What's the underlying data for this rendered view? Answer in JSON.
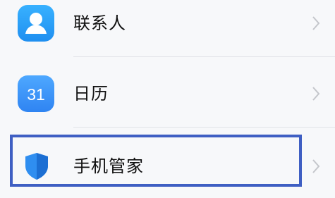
{
  "items": [
    {
      "label": "联系人",
      "icon": "contacts-icon"
    },
    {
      "label": "日历",
      "icon": "calendar-icon",
      "icon_text": "31"
    },
    {
      "label": "手机管家",
      "icon": "shield-icon"
    }
  ],
  "highlight_color": "#3f5fc3",
  "accent_color": "#2f8ef0"
}
